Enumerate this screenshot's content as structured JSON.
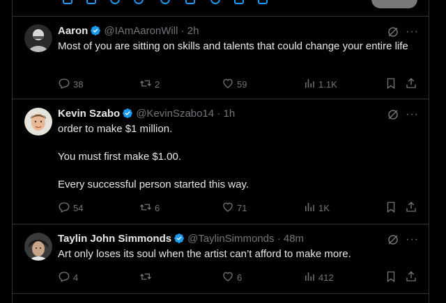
{
  "colors": {
    "background": "#000000",
    "text": "#e7e9ea",
    "muted": "#71767b",
    "accent": "#1d9bf0",
    "border": "#2f3336"
  },
  "tweets": [
    {
      "name": "Aaron",
      "handle": "@IAmAaronWill",
      "time": "· 2h",
      "lines": [
        "Most of you are sitting on skills and talents that could change your entire life"
      ],
      "replies": "38",
      "reposts": "2",
      "likes": "59",
      "views": "1.1K"
    },
    {
      "name": "Kevin Szabo",
      "handle": "@KevinSzabo14",
      "time": "· 1h",
      "lines": [
        "order to make $1 million.",
        "You must first make $1.00.",
        "Every successful person started this way."
      ],
      "replies": "54",
      "reposts": "6",
      "likes": "71",
      "views": "1K"
    },
    {
      "name": "Taylin John Simmonds",
      "handle": "@TaylinSimmonds",
      "time": "· 48m",
      "lines": [
        "Art only loses its soul when the artist can’t afford to make more."
      ],
      "replies": "4",
      "reposts": "",
      "likes": "6",
      "views": "412"
    }
  ],
  "icons": [
    "verified-badge-icon",
    "grok-icon",
    "more-icon",
    "reply-icon",
    "repost-icon",
    "like-icon",
    "views-icon",
    "bookmark-icon",
    "share-icon"
  ]
}
